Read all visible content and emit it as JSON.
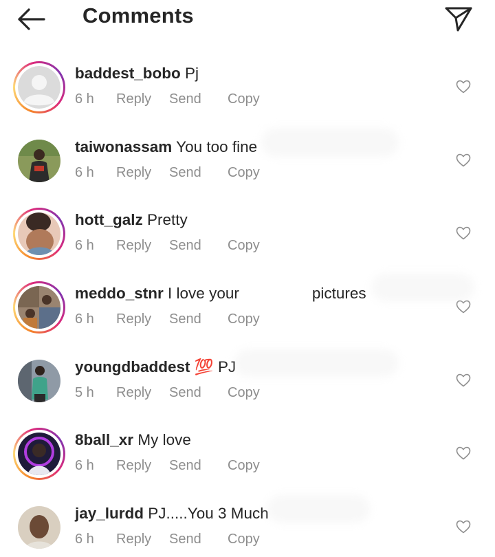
{
  "header": {
    "title": "Comments",
    "back_icon": "arrow-left-icon",
    "share_icon": "paper-plane-icon"
  },
  "colors": {
    "text": "#262626",
    "meta": "#8e8e8e",
    "story_ring": [
      "#f58529",
      "#dd2a7b",
      "#8134af"
    ]
  },
  "actions": {
    "reply": "Reply",
    "send": "Send",
    "copy": "Copy"
  },
  "comments": [
    {
      "username": "baddest_bobo",
      "text": "Pj",
      "time": "6 h",
      "story_ring": true,
      "avatar": "default-avatar"
    },
    {
      "username": "taiwonassam",
      "text": "You too fine",
      "time": "6 h",
      "story_ring": false,
      "avatar": "photo-avatar"
    },
    {
      "username": "hott_galz",
      "text": "Pretty",
      "time": "6 h",
      "story_ring": true,
      "avatar": "photo-avatar"
    },
    {
      "username": "meddo_stnr",
      "text": "I love your",
      "text_after": "pictures",
      "time": "6 h",
      "story_ring": true,
      "avatar": "photo-avatar"
    },
    {
      "username": "youngdbaddest",
      "text": "💯 PJ",
      "time": "5 h",
      "story_ring": false,
      "avatar": "photo-avatar"
    },
    {
      "username": "8ball_xr",
      "text": "My love",
      "time": "6 h",
      "story_ring": true,
      "avatar": "photo-avatar"
    },
    {
      "username": "jay_lurdd",
      "text": "PJ.....You 3 Much",
      "time": "6 h",
      "story_ring": false,
      "avatar": "photo-avatar"
    }
  ]
}
